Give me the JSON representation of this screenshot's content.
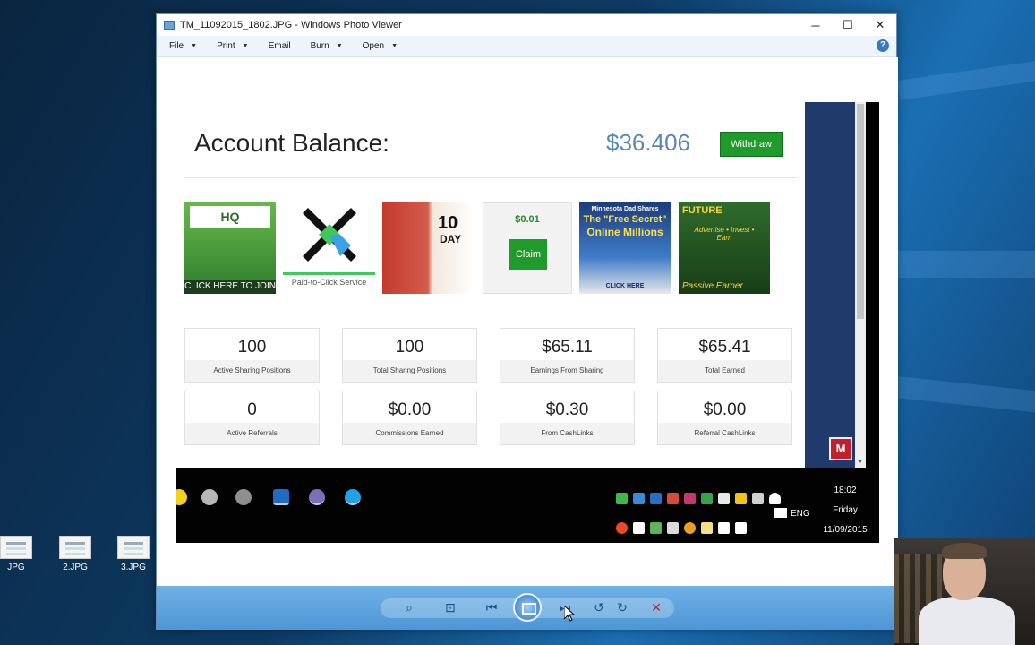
{
  "window": {
    "title": "TM_11092015_1802.JPG - Windows Photo Viewer",
    "minimize": "─",
    "maximize": "☐",
    "close": "✕",
    "help": "?"
  },
  "menu": {
    "items": [
      {
        "label": "File",
        "caret": true
      },
      {
        "label": "Print",
        "caret": true
      },
      {
        "label": "Email",
        "caret": false
      },
      {
        "label": "Burn",
        "caret": true
      },
      {
        "label": "Open",
        "caret": true
      }
    ]
  },
  "photo": {
    "balance_title": "Account Balance:",
    "balance_amount": "$36.406",
    "withdraw_label": "Withdraw",
    "banners": {
      "hq_logo": "HQ",
      "hq_cta": "CLICK HERE TO JOIN",
      "ptc_caption": "Paid-to-Click Service",
      "challenge_number": "10",
      "challenge_word": "DAY",
      "claim_amount": "$0.01",
      "claim_label": "Claim",
      "mn_line1": "Minnesota Dad Shares",
      "mn_line2": "The \"Free Secret\"",
      "mn_line3": "Online Millions",
      "mn_cta": "CLICK HERE",
      "future_title": "FUTURE",
      "future_sub": "Advertise • Invest • Earn",
      "future_tag": "Passive Earner"
    },
    "stats": [
      {
        "value": "100",
        "label": "Active Sharing Positions"
      },
      {
        "value": "100",
        "label": "Total Sharing Positions"
      },
      {
        "value": "$65.11",
        "label": "Earnings From Sharing"
      },
      {
        "value": "$65.41",
        "label": "Total Earned"
      },
      {
        "value": "0",
        "label": "Active Referrals"
      },
      {
        "value": "$0.00",
        "label": "Commissions Earned"
      },
      {
        "value": "$0.30",
        "label": "From CashLinks"
      },
      {
        "value": "$0.00",
        "label": "Referral CashLinks"
      }
    ],
    "taskbar": {
      "time": "18:02",
      "day": "Friday",
      "date": "11/09/2015",
      "lang": "ENG"
    }
  },
  "desktop": {
    "icons": [
      {
        "label": "JPG"
      },
      {
        "label": "2.JPG"
      },
      {
        "label": "3.JPG"
      }
    ]
  },
  "toolbar": {
    "zoom_icon": "⌕",
    "fit_icon": "⊡",
    "prev_icon": "⏮",
    "next_icon": "⏭",
    "rotate_left_icon": "↺",
    "rotate_right_icon": "↻",
    "delete_icon": "✕"
  },
  "colors": {
    "accent_green": "#1e9b2a",
    "balance_blue": "#5b87b4",
    "toolbar_blue": "#4e97d6"
  }
}
